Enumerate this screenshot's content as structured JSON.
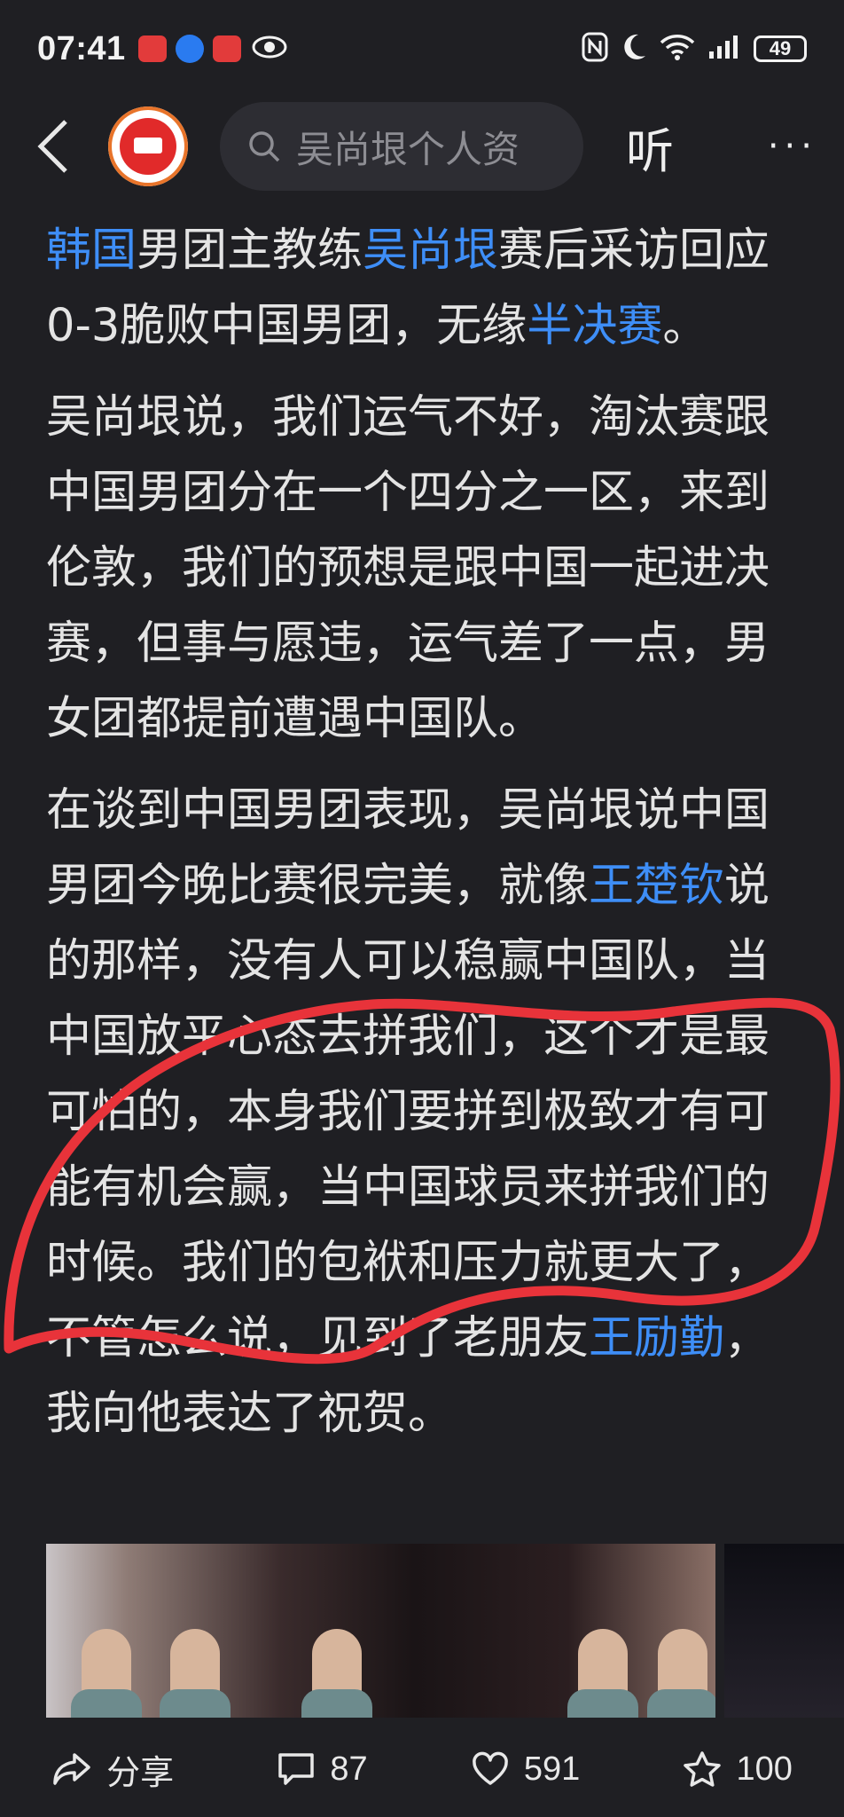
{
  "status_bar": {
    "time": "07:41",
    "battery": "49"
  },
  "nav": {
    "search_text": "吴尚垠个人资",
    "listen_label": "听",
    "more_label": "···"
  },
  "article": {
    "paragraphs": [
      [
        {
          "text": "韩国",
          "link": true
        },
        {
          "text": "男团主教练",
          "link": false
        },
        {
          "text": "吴尚垠",
          "link": true
        },
        {
          "text": "赛后采访回应0-3脆败中国男团，无缘",
          "link": false
        },
        {
          "text": "半决赛",
          "link": true
        },
        {
          "text": "。",
          "link": false
        }
      ],
      [
        {
          "text": "吴尚垠说，我们运气不好，淘汰赛跟中国男团分在一个四分之一区，来到伦敦，我们的预想是跟中国一起进决赛，但事与愿违，运气差了一点，男女团都提前遭遇中国队。",
          "link": false
        }
      ],
      [
        {
          "text": "在谈到中国男团表现，吴尚垠说中国男团今晚比赛很完美，就像",
          "link": false
        },
        {
          "text": "王楚钦",
          "link": true
        },
        {
          "text": "说的那样，没有人可以稳赢中国队，当中国放平心态去拼我们，这个才是最可怕的，本身我们要拼到极致才有可能有机会赢，当中国球员来拼我们的时候。我们的包袱和压力就更大了，不管怎么说，见到了老朋友",
          "link": false
        },
        {
          "text": "王励勤",
          "link": true
        },
        {
          "text": "，我向他表达了祝贺。",
          "link": false
        }
      ]
    ]
  },
  "actions": {
    "share_label": "分享",
    "comments": "87",
    "likes": "591",
    "favorites": "100"
  },
  "colors": {
    "background": "#1f1f23",
    "link": "#3e8ef7",
    "highlight": "#e8333a"
  }
}
